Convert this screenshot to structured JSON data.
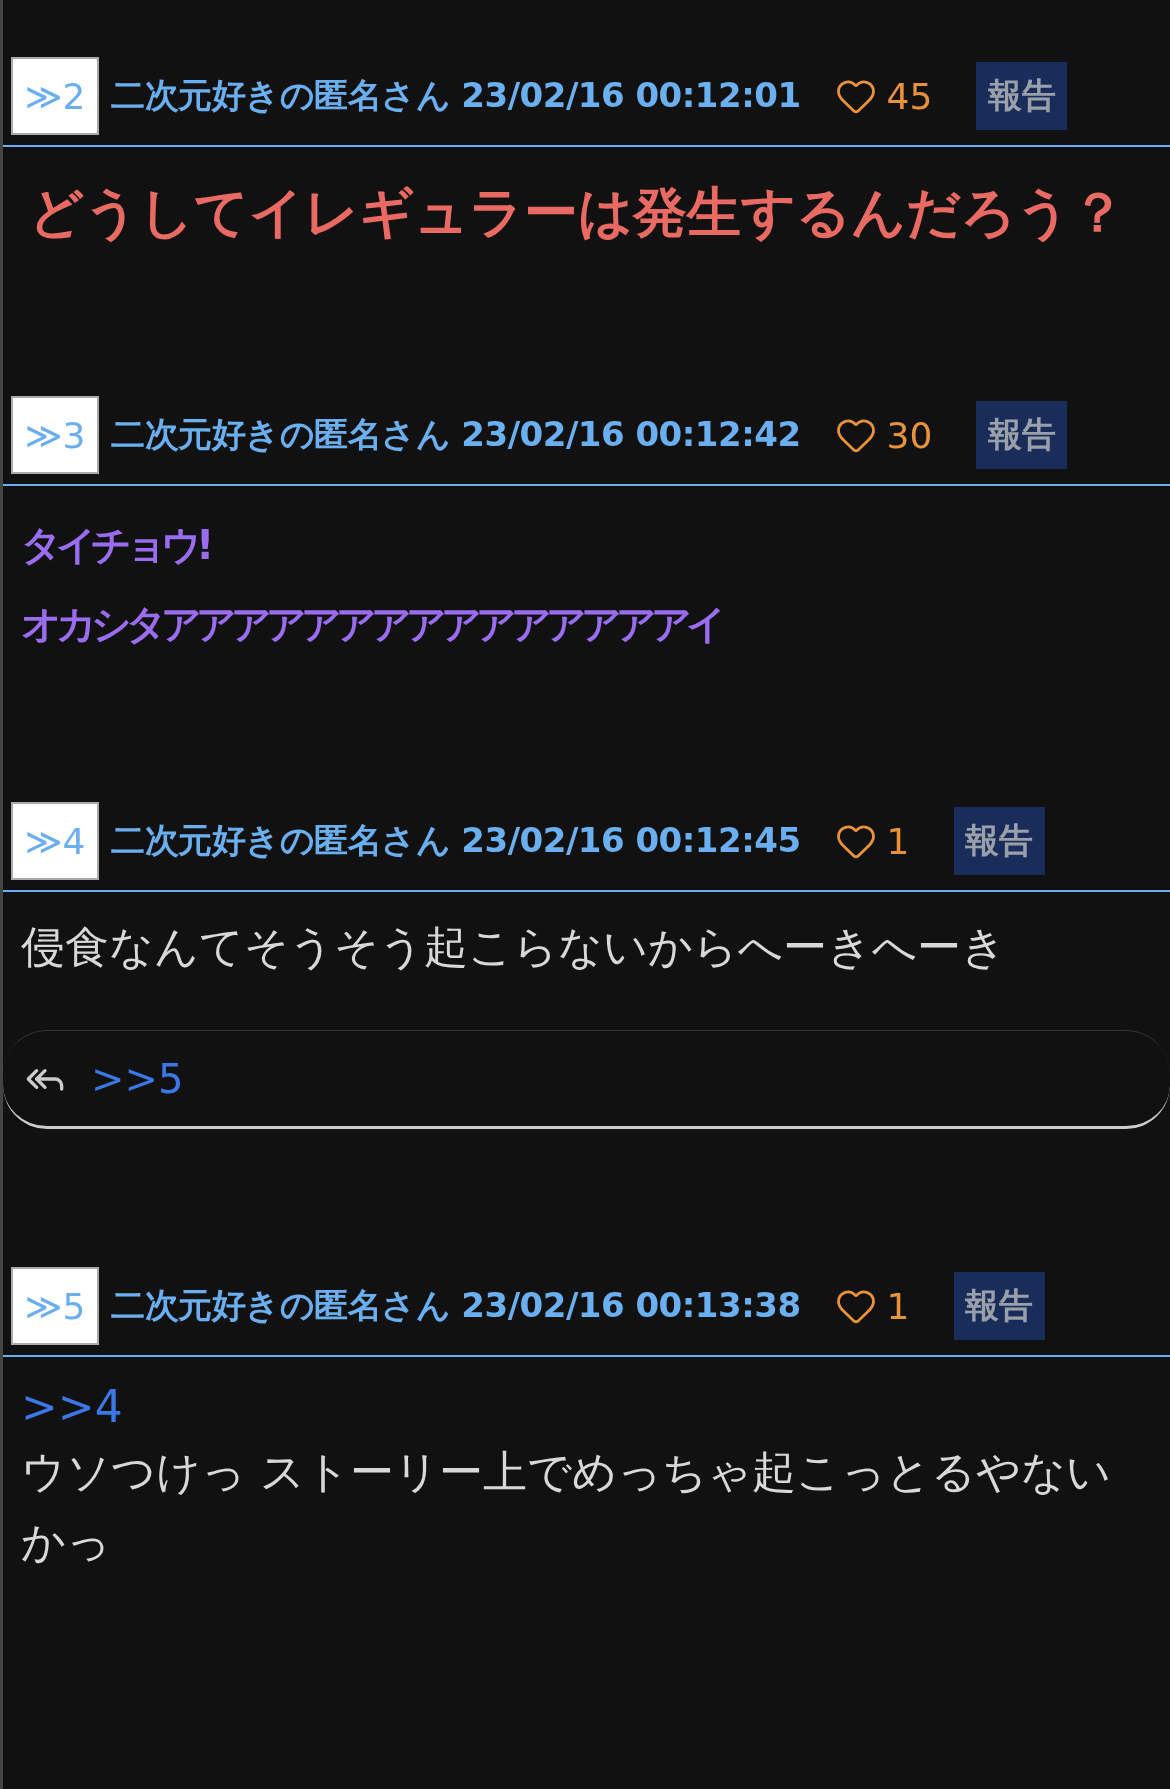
{
  "posts": [
    {
      "number": "≫2",
      "name": "二次元好きの匿名さん",
      "date": "23/02/16 00:12:01",
      "likes": "45",
      "report": "報告",
      "body": [
        {
          "kind": "headline",
          "text": "どうしてイレギュラーは発生するんだろう？"
        }
      ]
    },
    {
      "number": "≫3",
      "name": "二次元好きの匿名さん",
      "date": "23/02/16 00:12:42",
      "likes": "30",
      "report": "報告",
      "body": [
        {
          "kind": "shout",
          "text": "タイチョウ!"
        },
        {
          "kind": "shout",
          "text": "オカシタアアアアアアアアアアアアアアアイ"
        }
      ]
    },
    {
      "number": "≫4",
      "name": "二次元好きの匿名さん",
      "date": "23/02/16 00:12:45",
      "likes": "1",
      "report": "報告",
      "body": [
        {
          "kind": "plain",
          "text": "侵食なんてそうそう起こらないからへーきへーき"
        }
      ],
      "replies": ">>5"
    },
    {
      "number": "≫5",
      "name": "二次元好きの匿名さん",
      "date": "23/02/16 00:13:38",
      "likes": "1",
      "report": "報告",
      "body": [
        {
          "kind": "anchor",
          "text": ">>4"
        },
        {
          "kind": "plain",
          "text": "ウソつけっ ストーリー上でめっちゃ起こっとるやないかっ"
        }
      ]
    }
  ]
}
